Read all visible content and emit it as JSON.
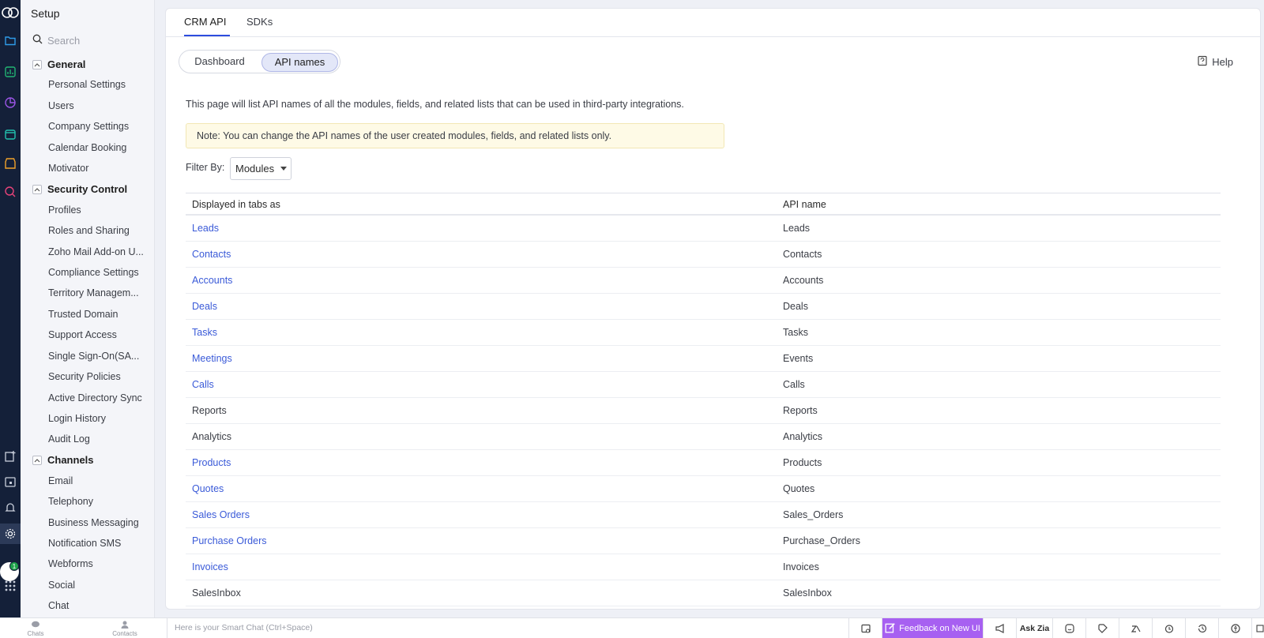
{
  "app": {
    "section": "Setup"
  },
  "sidebar": {
    "title": "Setup",
    "search_placeholder": "Search",
    "groups": [
      {
        "label": "General",
        "items": [
          "Personal Settings",
          "Users",
          "Company Settings",
          "Calendar Booking",
          "Motivator"
        ]
      },
      {
        "label": "Security Control",
        "items": [
          "Profiles",
          "Roles and Sharing",
          "Zoho Mail Add-on U...",
          "Compliance Settings",
          "Territory Managem...",
          "Trusted Domain",
          "Support Access",
          "Single Sign-On(SA...",
          "Security Policies",
          "Active Directory Sync",
          "Login History",
          "Audit Log"
        ]
      },
      {
        "label": "Channels",
        "items": [
          "Email",
          "Telephony",
          "Business Messaging",
          "Notification SMS",
          "Webforms",
          "Social",
          "Chat"
        ]
      }
    ]
  },
  "tabs": [
    "CRM API",
    "SDKs"
  ],
  "segment": {
    "options": [
      "Dashboard",
      "API names"
    ],
    "selected": "API names"
  },
  "help_label": "Help",
  "description": "This page will list API names of all the modules, fields, and related lists that can be used in third-party integrations.",
  "note": "Note: You can change the API names of the user created modules, fields, and related lists only.",
  "filter": {
    "label": "Filter By:",
    "value": "Modules"
  },
  "table": {
    "headers": [
      "Displayed in tabs as",
      "API name"
    ],
    "rows": [
      {
        "display": "Leads",
        "api": "Leads",
        "link": true
      },
      {
        "display": "Contacts",
        "api": "Contacts",
        "link": true
      },
      {
        "display": "Accounts",
        "api": "Accounts",
        "link": true
      },
      {
        "display": "Deals",
        "api": "Deals",
        "link": true
      },
      {
        "display": "Tasks",
        "api": "Tasks",
        "link": true
      },
      {
        "display": "Meetings",
        "api": "Events",
        "link": true
      },
      {
        "display": "Calls",
        "api": "Calls",
        "link": true
      },
      {
        "display": "Reports",
        "api": "Reports",
        "link": false
      },
      {
        "display": "Analytics",
        "api": "Analytics",
        "link": false
      },
      {
        "display": "Products",
        "api": "Products",
        "link": true
      },
      {
        "display": "Quotes",
        "api": "Quotes",
        "link": true
      },
      {
        "display": "Sales Orders",
        "api": "Sales_Orders",
        "link": true
      },
      {
        "display": "Purchase Orders",
        "api": "Purchase_Orders",
        "link": true
      },
      {
        "display": "Invoices",
        "api": "Invoices",
        "link": true
      },
      {
        "display": "SalesInbox",
        "api": "SalesInbox",
        "link": false
      }
    ]
  },
  "bottombar": {
    "chats": "Chats",
    "contacts": "Contacts",
    "smartchat_placeholder": "Here is your Smart Chat (Ctrl+Space)",
    "feedback": "Feedback on New UI",
    "askzia": "Ask Zia"
  },
  "avatar_badge": "1",
  "colors": {
    "rail": "#142039",
    "link": "#3a5ad8",
    "accent": "#2d4dde",
    "feedback": "#a760f1",
    "note_bg": "#fefae6"
  }
}
